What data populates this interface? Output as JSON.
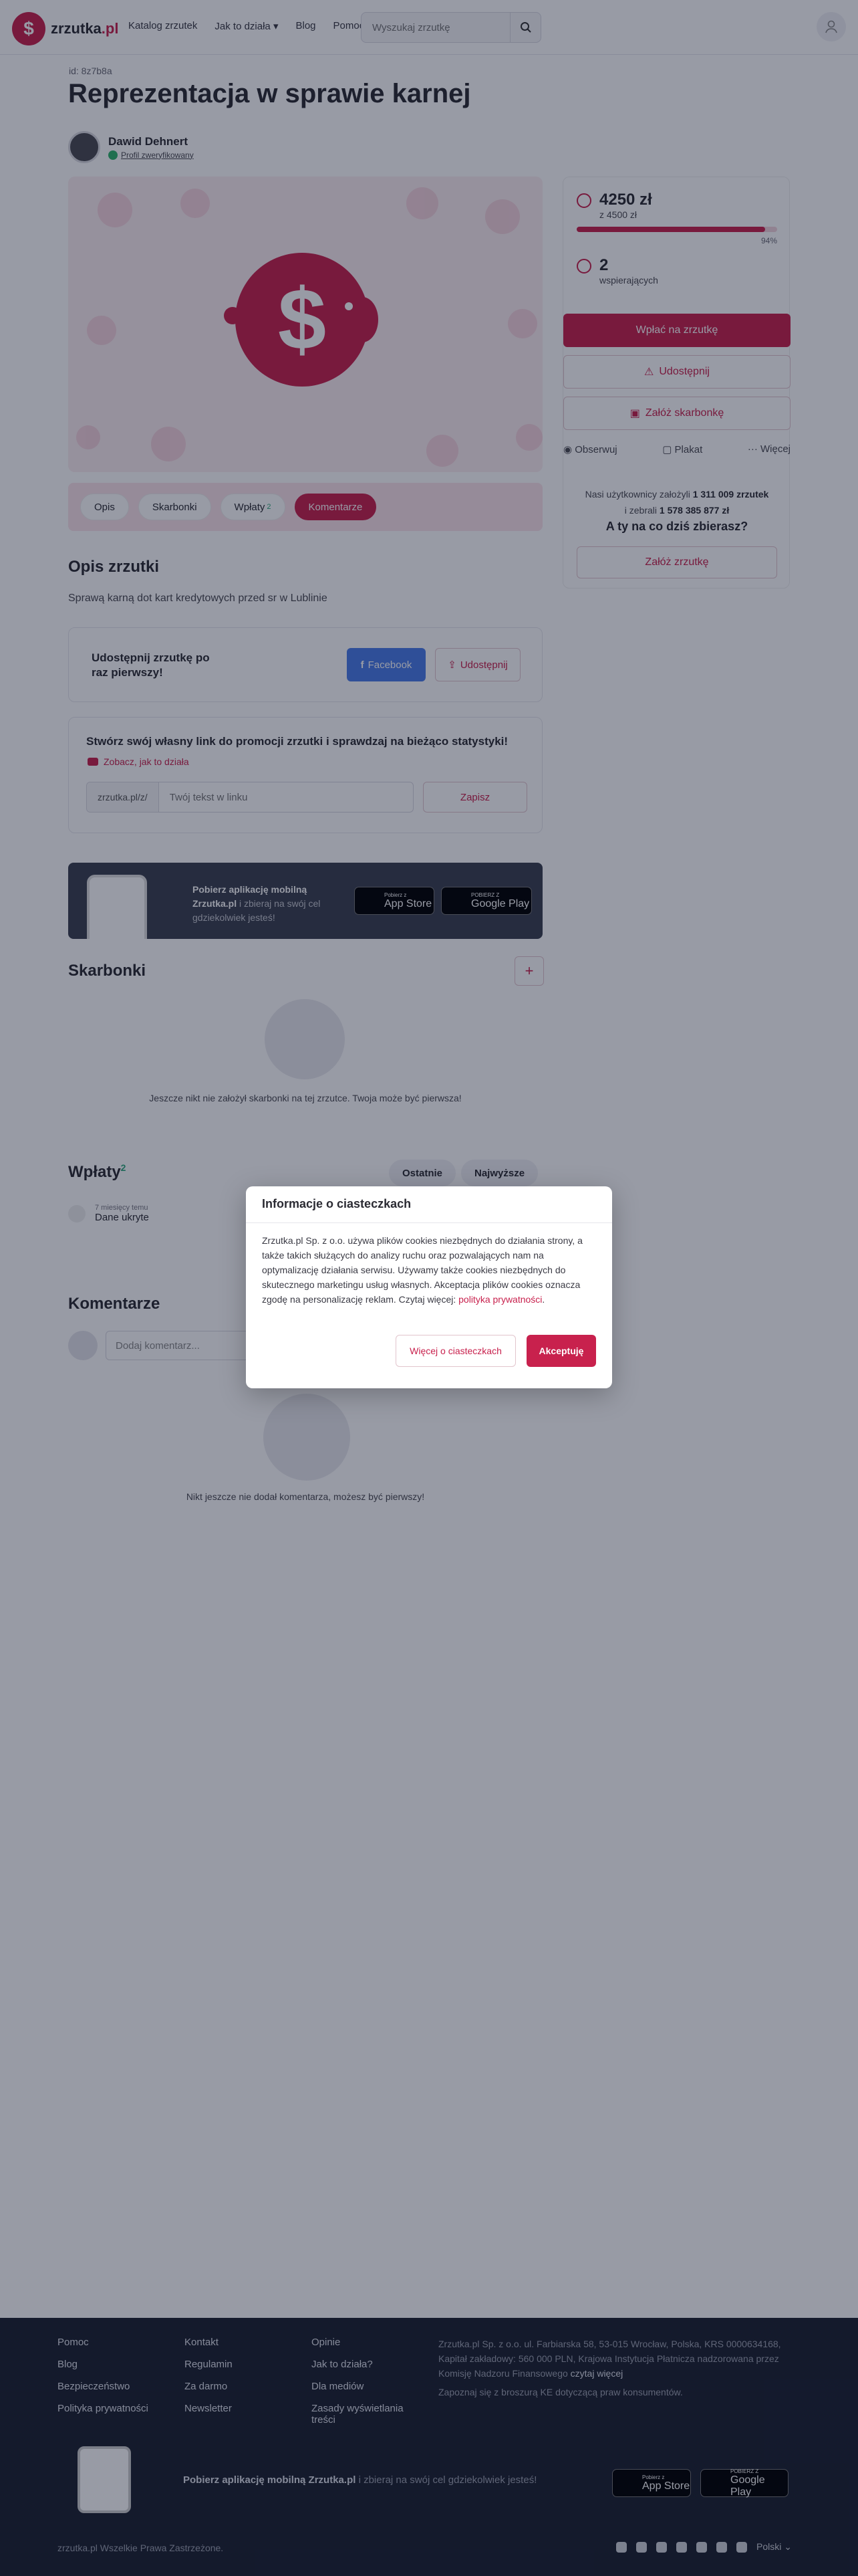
{
  "header": {
    "logo_text": "zrzutka",
    "logo_tld": ".pl",
    "nav": [
      "Katalog zrzutek",
      "Jak to działa",
      "Blog",
      "Pomoc"
    ],
    "search_placeholder": "Wyszukaj zrzutkę"
  },
  "page": {
    "id_label": "id: 8z7b8a",
    "title": "Reprezentacja w sprawie karnej",
    "author_name": "Dawid Dehnert",
    "author_verified": "Profil zweryfikowany"
  },
  "tabs": {
    "opis": "Opis",
    "skarbonki": "Skarbonki",
    "wplaty": "Wpłaty",
    "wplaty_count": "2",
    "komentarze": "Komentarze"
  },
  "description": {
    "heading": "Opis zrzutki",
    "text": "Sprawą karną dot kart kredytowych przed sr w Lublinie"
  },
  "share": {
    "text": "Udostępnij zrzutkę po raz pierwszy!",
    "facebook": "Facebook",
    "share": "Udostępnij"
  },
  "promo_link": {
    "title": "Stwórz swój własny link do promocji zrzutki i sprawdzaj na bieżąco statystyki!",
    "how_it_works": "Zobacz, jak to działa",
    "prefix": "zrzutka.pl/z/",
    "placeholder": "Twój tekst w linku",
    "save": "Zapisz"
  },
  "app_banner": {
    "bold": "Pobierz aplikację mobilną Zrzutka.pl",
    "rest": " i zbieraj na swój cel gdziekolwiek jesteś!",
    "appstore_small": "Pobierz z",
    "appstore": "App Store",
    "googleplay_small": "POBIERZ Z",
    "googleplay": "Google Play"
  },
  "skarbonki": {
    "heading": "Skarbonki",
    "add": "+",
    "empty": "Jeszcze nikt nie założył skarbonki na tej zrzutce. Twoja może być pierwsza!"
  },
  "wplaty": {
    "heading": "Wpłaty",
    "count": "2",
    "sort_recent": "Ostatnie",
    "sort_highest": "Najwyższe",
    "item_time": "7 miesięcy temu",
    "item_name": "Dane ukryte"
  },
  "komentarze": {
    "heading": "Komentarze",
    "placeholder": "Dodaj komentarz...",
    "empty": "Nikt jeszcze nie dodał komentarza, możesz być pierwszy!"
  },
  "sidebar": {
    "amount": "4250 zł",
    "goal": "z 4500 zł",
    "progress": 0.94,
    "progress_label": "94%",
    "supporters": "2",
    "supporters_label": "wspierających",
    "pay": "Wpłać na zrzutkę",
    "share": "Udostępnij",
    "piggy": "Załóż skarbonkę",
    "observe": "Obserwuj",
    "poster": "Plakat",
    "more": "Więcej",
    "stats_line1_pre": "Nasi użytkownicy założyli ",
    "stats_line1_num": "1 311 009 zrzutek",
    "stats_line2_pre": "i zebrali ",
    "stats_line2_num": "1 578 385 877 zł",
    "question": "A ty na co dziś zbierasz?",
    "create": "Załóż zrzutkę"
  },
  "cookies": {
    "title": "Informacje o ciasteczkach",
    "body": "Zrzutka.pl Sp. z o.o. używa plików cookies niezbędnych do działania strony, a także takich służących do analizy ruchu oraz pozwalających nam na optymalizację działania serwisu. Używamy także cookies niezbędnych do skutecznego marketingu usług własnych. Akceptacja plików cookies oznacza zgodę na personalizację reklam. Czytaj więcej: ",
    "policy_link": "polityka prywatności",
    "more": "Więcej o ciasteczkach",
    "accept": "Akceptuję"
  },
  "footer": {
    "col1": [
      "Pomoc",
      "Blog",
      "Bezpieczeństwo",
      "Polityka prywatności"
    ],
    "col2": [
      "Kontakt",
      "Regulamin",
      "Za darmo",
      "Newsletter"
    ],
    "col3": [
      "Opinie",
      "Jak to działa?",
      "Dla mediów",
      "Zasady wyświetlania treści"
    ],
    "company": "Zrzutka.pl Sp. z o.o. ul. Farbiarska 58, 53-015 Wrocław, Polska, KRS 0000634168, Kapitał zakładowy: 560 000 PLN, Krajowa Instytucja Płatnicza nadzorowana przez Komisję Nadzoru Finansowego ",
    "read_more": "czytaj więcej",
    "eu_note": "Zapoznaj się z broszurą KE dotyczącą praw konsumentów.",
    "banner_bold": "Pobierz aplikację mobilną Zrzutka.pl",
    "banner_rest": " i zbieraj na swój cel gdziekolwiek jesteś!",
    "copyright": "zrzutka.pl Wszelkie Prawa Zastrzeżone.",
    "language": "Polski"
  },
  "colors": {
    "brand": "#c8214d",
    "footer_bg": "#1c2130"
  }
}
